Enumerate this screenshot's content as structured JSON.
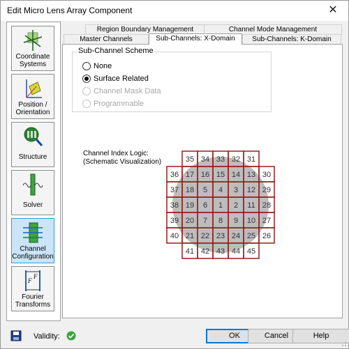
{
  "window": {
    "title": "Edit Micro Lens Array Component",
    "close_glyph": "✕"
  },
  "sidebar": {
    "items": [
      {
        "label_lines": [
          "Coordinate",
          "Systems"
        ],
        "icon": "coordinate-systems-icon"
      },
      {
        "label_lines": [
          "Position /",
          "Orientation"
        ],
        "icon": "position-orientation-icon"
      },
      {
        "label_lines": [
          "Structure"
        ],
        "icon": "structure-icon"
      },
      {
        "label_lines": [
          "Solver"
        ],
        "icon": "solver-icon"
      },
      {
        "label_lines": [
          "Channel",
          "Configuration"
        ],
        "icon": "channel-configuration-icon",
        "selected": true
      },
      {
        "label_lines": [
          "Fourier",
          "Transforms"
        ],
        "icon": "fourier-transforms-icon"
      }
    ]
  },
  "tabs": {
    "row1": [
      "Region Boundary Management",
      "Channel Mode Management"
    ],
    "row2": [
      "Master Channels",
      "Sub-Channels: X-Domain",
      "Sub-Channels: K-Domain"
    ],
    "active": "Sub-Channels: X-Domain"
  },
  "scheme": {
    "title": "Sub-Channel Scheme",
    "options": [
      {
        "label": "None",
        "checked": false,
        "disabled": false
      },
      {
        "label": "Surface Related",
        "checked": true,
        "disabled": false
      },
      {
        "label": "Channel Mask Data",
        "checked": false,
        "disabled": true
      },
      {
        "label": "Programmable",
        "checked": false,
        "disabled": true
      }
    ]
  },
  "logic": {
    "label_line1": "Channel Index Logic:",
    "label_line2": "(Schematic Visualization)",
    "grid": [
      [
        null,
        "35",
        "34",
        "33",
        "32",
        "31",
        null
      ],
      [
        "36",
        "17",
        "16",
        "15",
        "14",
        "13",
        "30"
      ],
      [
        "37",
        "18",
        "5",
        "4",
        "3",
        "12",
        "29"
      ],
      [
        "38",
        "19",
        "6",
        "1",
        "2",
        "11",
        "28"
      ],
      [
        "39",
        "20",
        "7",
        "8",
        "9",
        "10",
        "27"
      ],
      [
        "40",
        "21",
        "22",
        "23",
        "24",
        "25",
        "26"
      ],
      [
        null,
        "41",
        "42",
        "43",
        "44",
        "45",
        null
      ]
    ]
  },
  "footer": {
    "validity_label": "Validity:",
    "ok": "OK",
    "cancel": "Cancel",
    "help": "Help"
  },
  "colors": {
    "accent": "#0078d7",
    "cell_border": "#9b1b1b",
    "circle_fill": "#bdbdbd",
    "selected_nav": "#cce4f7",
    "valid_green": "#3aa53a"
  }
}
